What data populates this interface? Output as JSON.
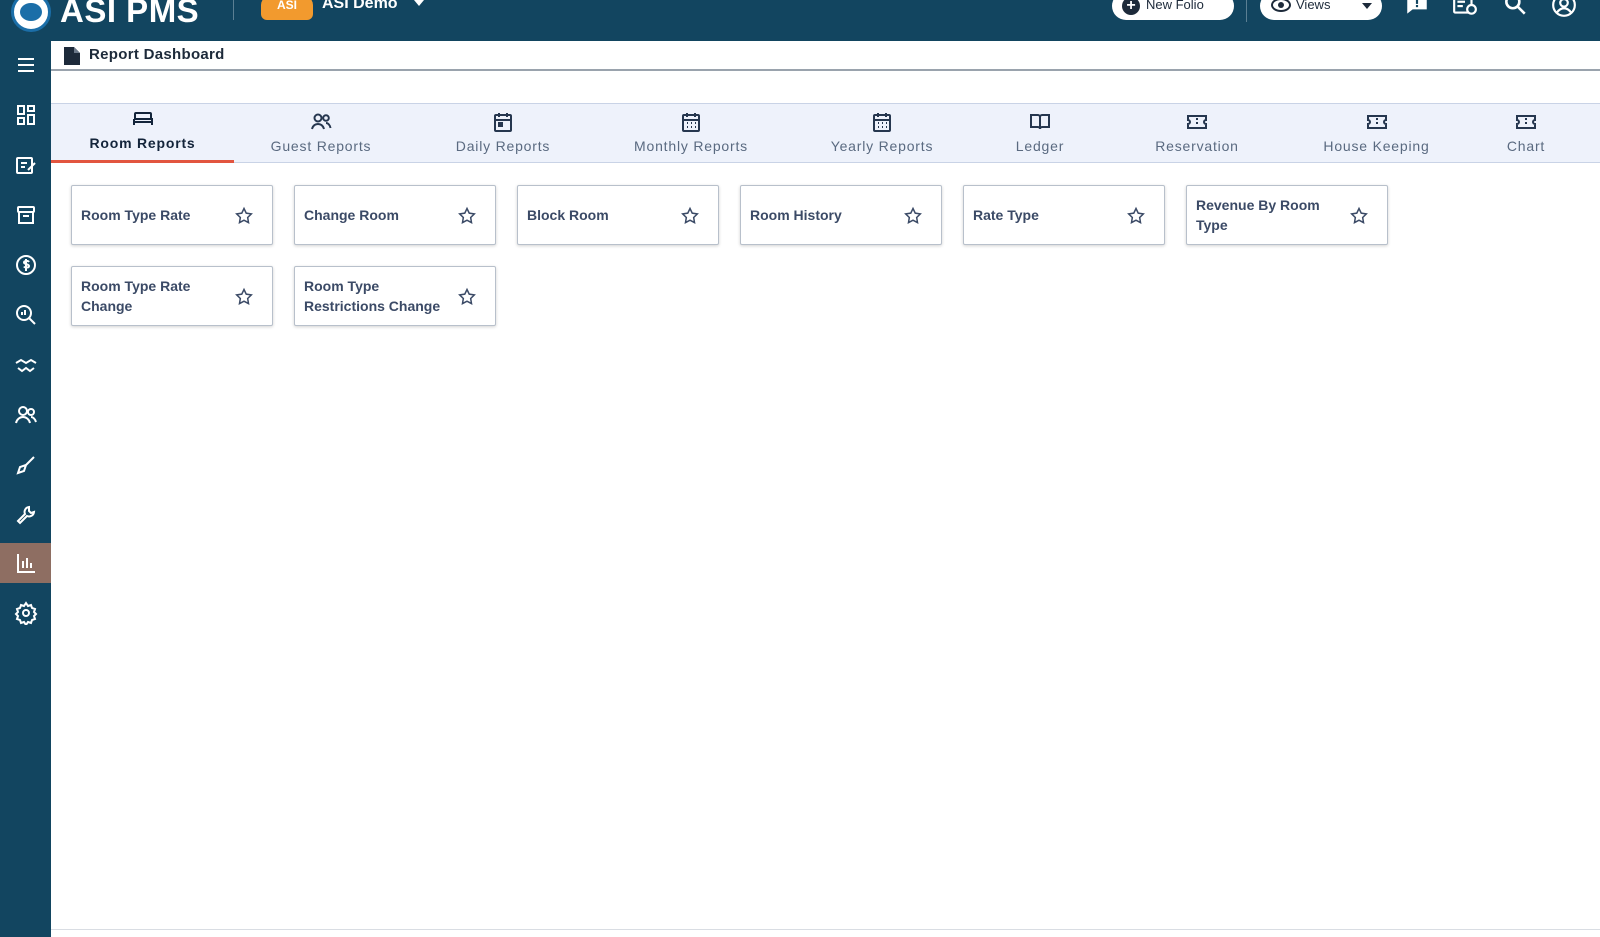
{
  "app": {
    "brand": "ASI PMS",
    "property_badge": "ASI",
    "property_name": "ASI Demo"
  },
  "toolbar": {
    "new_folio_label": "New Folio",
    "views_label": "Views",
    "icons": [
      "chat-alert-icon",
      "folio-list-icon",
      "search-icon",
      "user-account-icon"
    ]
  },
  "sidebar": {
    "items": [
      {
        "icon": "menu-icon"
      },
      {
        "icon": "dashboard-icon"
      },
      {
        "icon": "reservation-edit-icon"
      },
      {
        "icon": "store-icon"
      },
      {
        "icon": "dollar-icon"
      },
      {
        "icon": "search-analytics-icon"
      },
      {
        "icon": "handshake-icon"
      },
      {
        "icon": "guests-icon"
      },
      {
        "icon": "housekeeping-icon"
      },
      {
        "icon": "wrench-icon"
      },
      {
        "icon": "reports-chart-icon",
        "active": true
      },
      {
        "icon": "settings-icon"
      }
    ],
    "active_color": "#8e6e62"
  },
  "breadcrumb": {
    "label": "Report Dashboard"
  },
  "tabs": [
    {
      "label": "Room Reports",
      "icon": "bed-icon",
      "active": true
    },
    {
      "label": "Guest Reports",
      "icon": "guests-icon"
    },
    {
      "label": "Daily Reports",
      "icon": "calendar-day-icon"
    },
    {
      "label": "Monthly Reports",
      "icon": "calendar-month-icon"
    },
    {
      "label": "Yearly Reports",
      "icon": "calendar-year-icon"
    },
    {
      "label": "Ledger",
      "icon": "book-icon"
    },
    {
      "label": "Reservation",
      "icon": "ticket-icon"
    },
    {
      "label": "House Keeping",
      "icon": "ticket-icon"
    },
    {
      "label": "Chart",
      "icon": "ticket-icon"
    }
  ],
  "reports": [
    {
      "title": "Room Type Rate"
    },
    {
      "title": "Change Room"
    },
    {
      "title": "Block Room"
    },
    {
      "title": "Room History"
    },
    {
      "title": "Rate Type"
    },
    {
      "title": "Revenue By Room Type"
    },
    {
      "title": "Room Type Rate Change"
    },
    {
      "title": "Room Type Restrictions Change"
    }
  ],
  "colors": {
    "topbar": "#124560",
    "tab_active_underline": "#e2553f",
    "tabbar_bg": "#eef2fb"
  }
}
